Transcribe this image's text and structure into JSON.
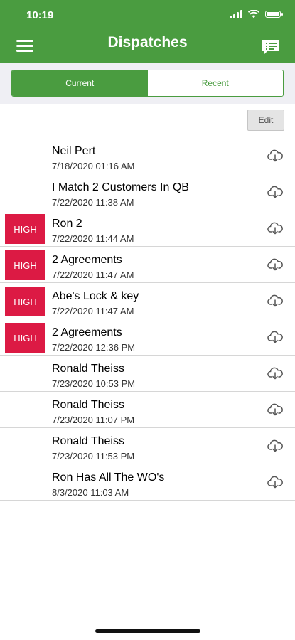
{
  "status_bar": {
    "time": "10:19"
  },
  "header": {
    "title": "Dispatches"
  },
  "tabs": [
    {
      "label": "Current",
      "active": true
    },
    {
      "label": "Recent",
      "active": false
    }
  ],
  "toolbar": {
    "edit_label": "Edit"
  },
  "dispatches": [
    {
      "name": "Neil Pert",
      "date": "7/18/2020 01:16 AM",
      "priority": ""
    },
    {
      "name": "I Match 2 Customers In QB",
      "date": "7/22/2020 11:38 AM",
      "priority": ""
    },
    {
      "name": "Ron 2",
      "date": "7/22/2020 11:44 AM",
      "priority": "HIGH"
    },
    {
      "name": "2 Agreements",
      "date": "7/22/2020 11:47 AM",
      "priority": "HIGH"
    },
    {
      "name": "Abe's Lock & key",
      "date": "7/22/2020 11:47 AM",
      "priority": "HIGH"
    },
    {
      "name": "2 Agreements",
      "date": "7/22/2020 12:36 PM",
      "priority": "HIGH"
    },
    {
      "name": "Ronald Theiss",
      "date": "7/23/2020 10:53 PM",
      "priority": ""
    },
    {
      "name": "Ronald Theiss",
      "date": "7/23/2020 11:07 PM",
      "priority": ""
    },
    {
      "name": "Ronald Theiss",
      "date": "7/23/2020 11:53 PM",
      "priority": ""
    },
    {
      "name": "Ron Has All The WO's",
      "date": "8/3/2020 11:03 AM",
      "priority": ""
    }
  ],
  "icons": {
    "menu": "hamburger-menu-icon",
    "message": "message-icon",
    "download": "cloud-download-icon"
  },
  "colors": {
    "brand_green": "#4a9c40",
    "priority_red": "#dc1a44"
  }
}
